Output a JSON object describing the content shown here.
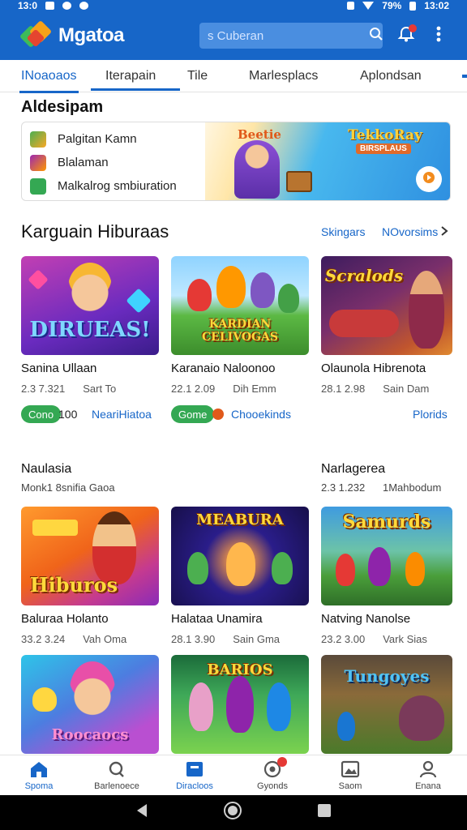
{
  "status_bar": {
    "time": "13:0",
    "battery": "79%",
    "right_time": "13:02"
  },
  "app": {
    "title": "Mgatoa"
  },
  "search": {
    "placeholder": "s Cuberan"
  },
  "tabs": [
    {
      "label": "INoaoaos"
    },
    {
      "label": "Iterapain"
    },
    {
      "label": "Tile"
    },
    {
      "label": "Marlesplacs"
    },
    {
      "label": "Aplondsan"
    }
  ],
  "promo": {
    "title": "Aldesipam",
    "items": [
      {
        "label": "Palgitan Kamn",
        "icon": "game-icon"
      },
      {
        "label": "Blalaman",
        "icon": "puzzle-icon"
      },
      {
        "label": "Malkalrog smbiuration",
        "icon": "leaf-icon"
      }
    ],
    "art_title": "Beetie",
    "art_brand": "TekkoRay",
    "art_sub": "BIRSPLAUS"
  },
  "section": {
    "title": "Karguain Hiburaas",
    "link_a": "Skingars",
    "link_b": "NOvorsims"
  },
  "row1": [
    {
      "logo": "DIRUEAS!",
      "title": "Sanina Ullaan",
      "meta_a": "2.3 7.321",
      "meta_b": "Sart To"
    },
    {
      "logo": "KARDIAN CELIVOGAS",
      "title": "Karanaio Naloonoo",
      "meta_a": "22.1 2.09",
      "meta_b": "Dih Emm"
    },
    {
      "logo": "Scralods",
      "title": "Olaunola Hibrenota",
      "meta_a": "28.1 2.98",
      "meta_b": "Sain Dam"
    }
  ],
  "row1_actions": {
    "chip1": "Cono",
    "chip1_value": "100",
    "link1": "NeariHiatoa",
    "chip2": "Gome",
    "link2": "Chooekinds",
    "link3": "Plorids"
  },
  "group": {
    "left_title": "Naulasia",
    "left_sub": "Monk1 8snifia Gaoa",
    "right_title": "Narlagerea",
    "right_sub_a": "2.3 1.232",
    "right_sub_b": "1Mahbodum"
  },
  "row2": [
    {
      "logo": "Hiburos",
      "title": "Baluraa Holanto",
      "meta_a": "33.2 3.24",
      "meta_b": "Vah Oma"
    },
    {
      "logo": "MEABURA",
      "title": "Halataa Unamira",
      "meta_a": "28.1 3.90",
      "meta_b": "Sain Gma"
    },
    {
      "logo": "Samurds",
      "title": "Natving Nanolse",
      "meta_a": "23.2 3.00",
      "meta_b": "Vark Sias"
    }
  ],
  "row3": [
    {
      "logo": "Roocaocs"
    },
    {
      "logo": "BARIOS"
    },
    {
      "logo": "Tungoyes"
    }
  ],
  "bottom_nav": [
    {
      "label": "Spoma",
      "icon": "home-icon"
    },
    {
      "label": "Barlenoece",
      "icon": "search-icon"
    },
    {
      "label": "Diracloos",
      "icon": "store-icon"
    },
    {
      "label": "Gyonds",
      "icon": "target-icon"
    },
    {
      "label": "Saom",
      "icon": "image-icon"
    },
    {
      "label": "Enana",
      "icon": "person-icon"
    }
  ],
  "colors": {
    "primary": "#1766c8",
    "green": "#34a853",
    "badge": "#e53935"
  }
}
